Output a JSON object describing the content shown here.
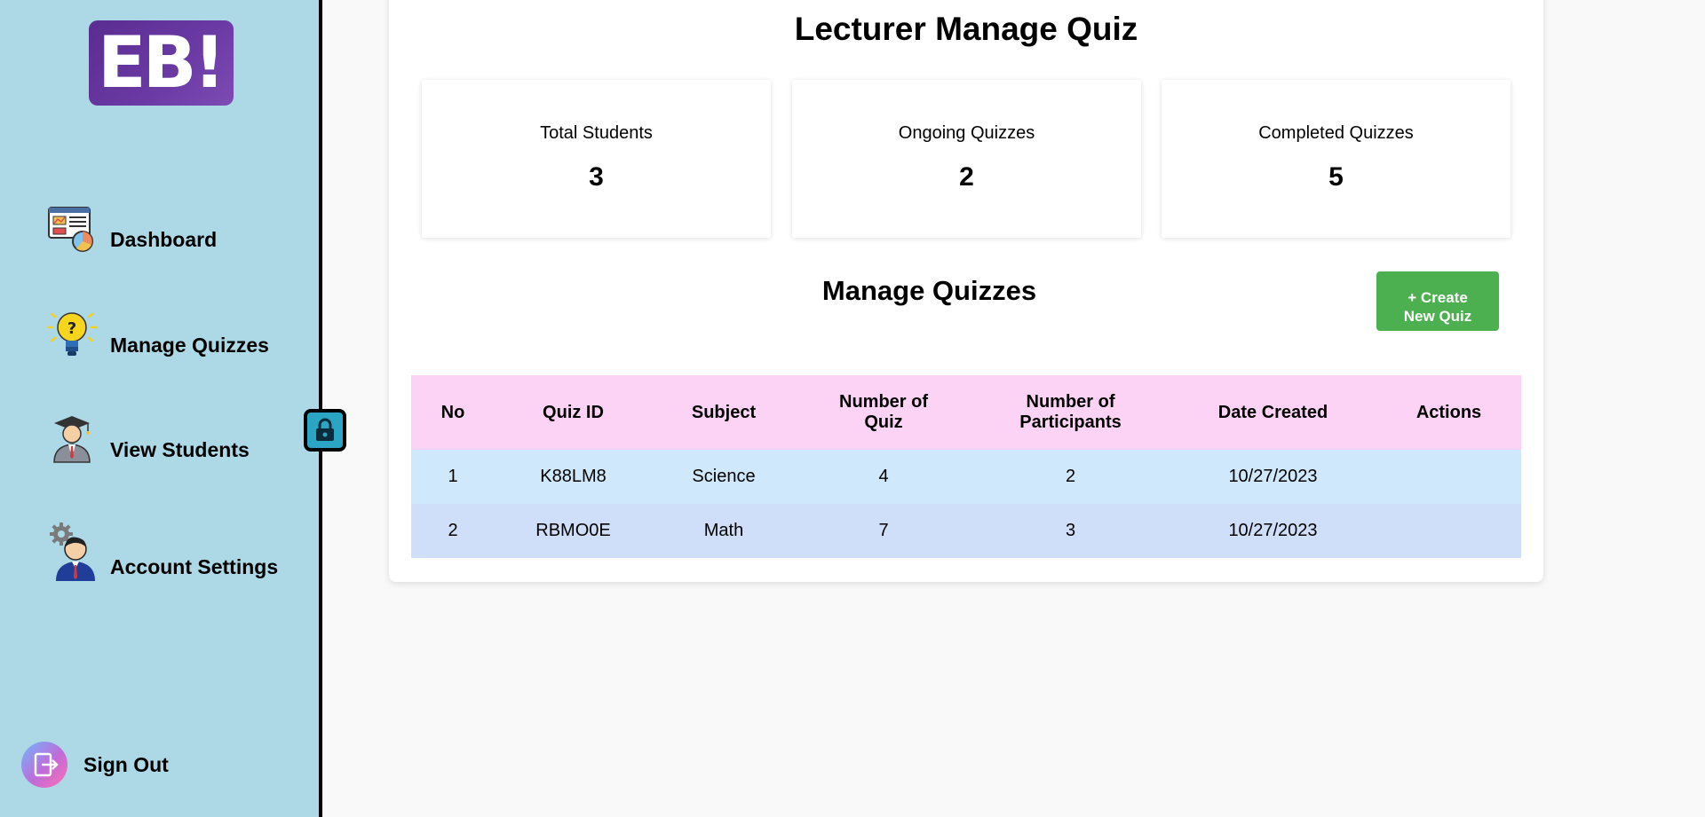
{
  "brand": {
    "logo_text": "EB!"
  },
  "sidebar": {
    "items": [
      {
        "label": "Dashboard",
        "icon": "dashboard-icon"
      },
      {
        "label": "Manage Quizzes",
        "icon": "lightbulb-question-icon"
      },
      {
        "label": "View Students",
        "icon": "graduate-student-icon"
      },
      {
        "label": "Account Settings",
        "icon": "user-gear-icon"
      }
    ],
    "sign_out": "Sign Out"
  },
  "page": {
    "title": "Lecturer Manage Quiz"
  },
  "stats": [
    {
      "label": "Total Students",
      "value": "3"
    },
    {
      "label": "Ongoing Quizzes",
      "value": "2"
    },
    {
      "label": "Completed Quizzes",
      "value": "5"
    }
  ],
  "manage": {
    "title": "Manage Quizzes",
    "create_button": "+ Create\nNew Quiz"
  },
  "table": {
    "headers": [
      "No",
      "Quiz ID",
      "Subject",
      "Number of\nQuiz",
      "Number of\nParticipants",
      "Date Created",
      "Actions"
    ],
    "rows": [
      [
        "1",
        "K88LM8",
        "Science",
        "4",
        "2",
        "10/27/2023",
        ""
      ],
      [
        "2",
        "RBMO0E",
        "Math",
        "7",
        "3",
        "10/27/2023",
        ""
      ]
    ]
  },
  "colors": {
    "sidebar_bg": "#add8e6",
    "create_button": "#4caf50",
    "table_header": "#fdd3f5",
    "row_1": "#cfe8fc",
    "row_2": "#cfdffa"
  }
}
